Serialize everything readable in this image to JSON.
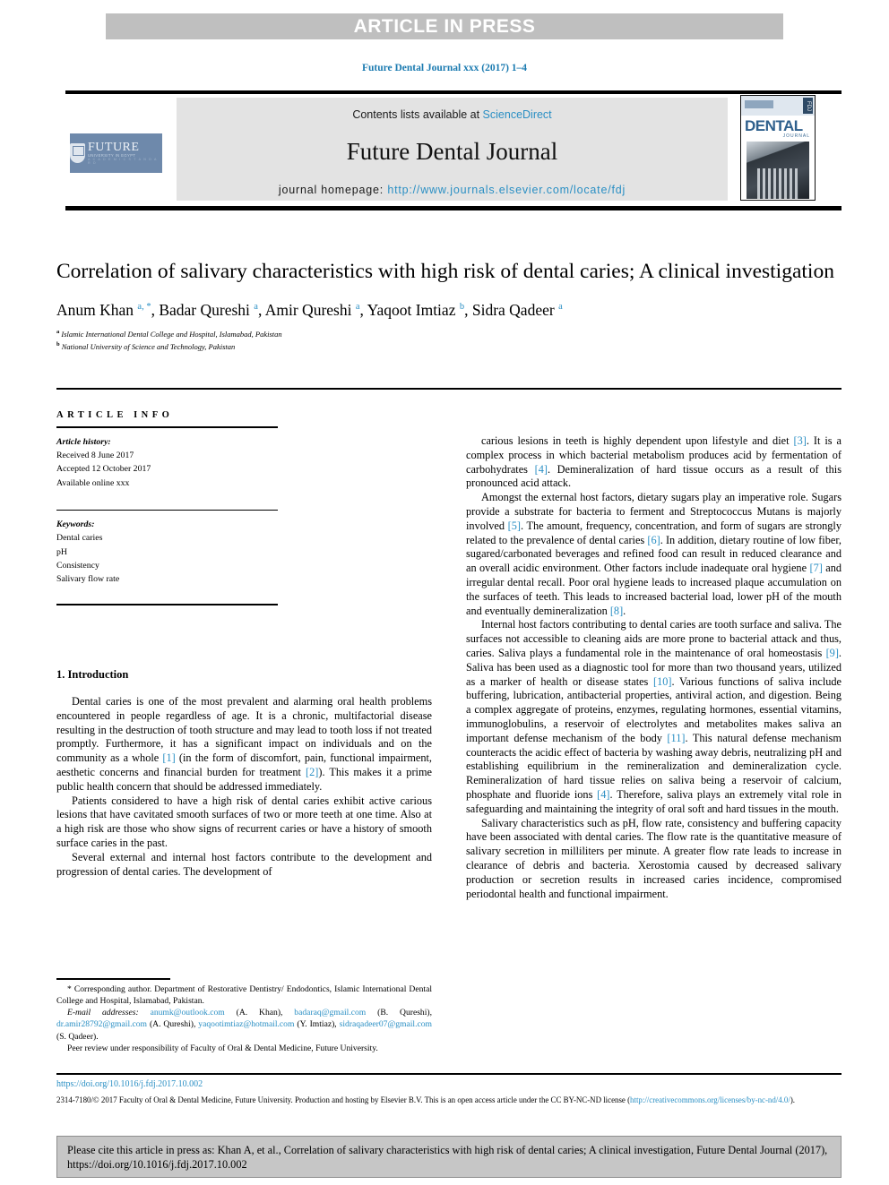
{
  "banner": {
    "text": "ARTICLE IN PRESS"
  },
  "journal_ref": "Future Dental Journal xxx (2017) 1–4",
  "masthead": {
    "contents_prefix": "Contents lists available at ",
    "contents_link": "ScienceDirect",
    "journal_title": "Future Dental Journal",
    "homepage_prefix": "journal homepage: ",
    "homepage_link": "http://www.journals.elsevier.com/locate/fdj",
    "publisher_logo_line1": "FUTURE",
    "publisher_logo_line2": "UNIVERSITY IN EGYPT",
    "publisher_logo_line3": "A C A D E M I C   S T A N D A R D",
    "cover_word": "DENTAL",
    "cover_sub": "JOURNAL",
    "cover_spine": "FDJ"
  },
  "article": {
    "title": "Correlation of salivary characteristics with high risk of dental caries; A clinical investigation",
    "authors_html": "Anum Khan <sup>a, *</sup>, Badar Qureshi <sup>a</sup>, Amir Qureshi <sup>a</sup>, Yaqoot Imtiaz <sup>b</sup>, Sidra Qadeer <sup>a</sup>",
    "affiliation_a": "Islamic International Dental College and Hospital, Islamabad, Pakistan",
    "affiliation_b": "National University of Science and Technology, Pakistan"
  },
  "article_info": {
    "heading": "ARTICLE INFO",
    "history_label": "Article history:",
    "history": [
      "Received 8 June 2017",
      "Accepted 12 October 2017",
      "Available online xxx"
    ],
    "keywords_label": "Keywords:",
    "keywords": [
      "Dental caries",
      "pH",
      "Consistency",
      "Salivary flow rate"
    ]
  },
  "body": {
    "section_1_heading": "1. Introduction",
    "left_paragraphs": [
      "Dental caries is one of the most prevalent and alarming oral health problems encountered in people regardless of age. It is a chronic, multifactorial disease resulting in the destruction of tooth structure and may lead to tooth loss if not treated promptly. Furthermore, it has a significant impact on individuals and on the community as a whole [1] (in the form of discomfort, pain, functional impairment, aesthetic concerns and financial burden for treatment [2]). This makes it a prime public health concern that should be addressed immediately.",
      "Patients considered to have a high risk of dental caries exhibit active carious lesions that have cavitated smooth surfaces of two or more teeth at one time. Also at a high risk are those who show signs of recurrent caries or have a history of smooth surface caries in the past.",
      "Several external and internal host factors contribute to the development and progression of dental caries. The development of"
    ],
    "right_paragraphs": [
      "carious lesions in teeth is highly dependent upon lifestyle and diet [3]. It is a complex process in which bacterial metabolism produces acid by fermentation of carbohydrates [4]. Demineralization of hard tissue occurs as a result of this pronounced acid attack.",
      "Amongst the external host factors, dietary sugars play an imperative role. Sugars provide a substrate for bacteria to ferment and Streptococcus Mutans is majorly involved [5]. The amount, frequency, concentration, and form of sugars are strongly related to the prevalence of dental caries [6]. In addition, dietary routine of low fiber, sugared/carbonated beverages and refined food can result in reduced clearance and an overall acidic environment. Other factors include inadequate oral hygiene [7] and irregular dental recall. Poor oral hygiene leads to increased plaque accumulation on the surfaces of teeth. This leads to increased bacterial load, lower pH of the mouth and eventually demineralization [8].",
      "Internal host factors contributing to dental caries are tooth surface and saliva. The surfaces not accessible to cleaning aids are more prone to bacterial attack and thus, caries. Saliva plays a fundamental role in the maintenance of oral homeostasis [9]. Saliva has been used as a diagnostic tool for more than two thousand years, utilized as a marker of health or disease states [10]. Various functions of saliva include buffering, lubrication, antibacterial properties, antiviral action, and digestion. Being a complex aggregate of proteins, enzymes, regulating hormones, essential vitamins, immunoglobulins, a reservoir of electrolytes and metabolites makes saliva an important defense mechanism of the body [11]. This natural defense mechanism counteracts the acidic effect of bacteria by washing away debris, neutralizing pH and establishing equilibrium in the remineralization and demineralization cycle. Remineralization of hard tissue relies on saliva being a reservoir of calcium, phosphate and fluoride ions [4]. Therefore, saliva plays an extremely vital role in safeguarding and maintaining the integrity of oral soft and hard tissues in the mouth.",
      "Salivary characteristics such as pH, flow rate, consistency and buffering capacity have been associated with dental caries. The flow rate is the quantitative measure of salivary secretion in milliliters per minute. A greater flow rate leads to increase in clearance of debris and bacteria. Xerostomia caused by decreased salivary production or secretion results in increased caries incidence, compromised periodontal health and functional impairment."
    ]
  },
  "footnotes": {
    "corresponding": "* Corresponding author. Department of Restorative Dentistry/ Endodontics, Islamic International Dental College and Hospital, Islamabad, Pakistan.",
    "email_label": "E-mail addresses:",
    "emails": [
      {
        "address": "anumk@outlook.com",
        "owner": "(A. Khan)"
      },
      {
        "address": "badaraq@gmail.com",
        "owner": "(B. Qureshi)"
      },
      {
        "address": "dr.amir28792@gmail.com",
        "owner": "(A. Qureshi)"
      },
      {
        "address": "yaqootimtiaz@hotmail.com",
        "owner": "(Y. Imtiaz)"
      },
      {
        "address": "sidraqadeer07@gmail.com",
        "owner": "(S. Qadeer)"
      }
    ],
    "peer_review": "Peer review under responsibility of Faculty of Oral & Dental Medicine, Future University."
  },
  "license": {
    "doi": "https://doi.org/10.1016/j.fdj.2017.10.002",
    "text_before_link": "2314-7180/© 2017 Faculty of Oral & Dental Medicine, Future University. Production and hosting by Elsevier B.V. This is an open access article under the CC BY-NC-ND license (",
    "link": "http://creativecommons.org/licenses/by-nc-nd/4.0/",
    "text_after_link": ")."
  },
  "cite_box": {
    "text": "Please cite this article in press as: Khan A, et al., Correlation of salivary characteristics with high risk of dental caries; A clinical investigation, Future Dental Journal (2017), https://doi.org/10.1016/j.fdj.2017.10.002"
  },
  "colors": {
    "link": "#2a8fc4",
    "banner_bg": "#bfbfbf",
    "masthead_bg": "#e3e3e3",
    "cite_bg": "#c6c6c6"
  }
}
